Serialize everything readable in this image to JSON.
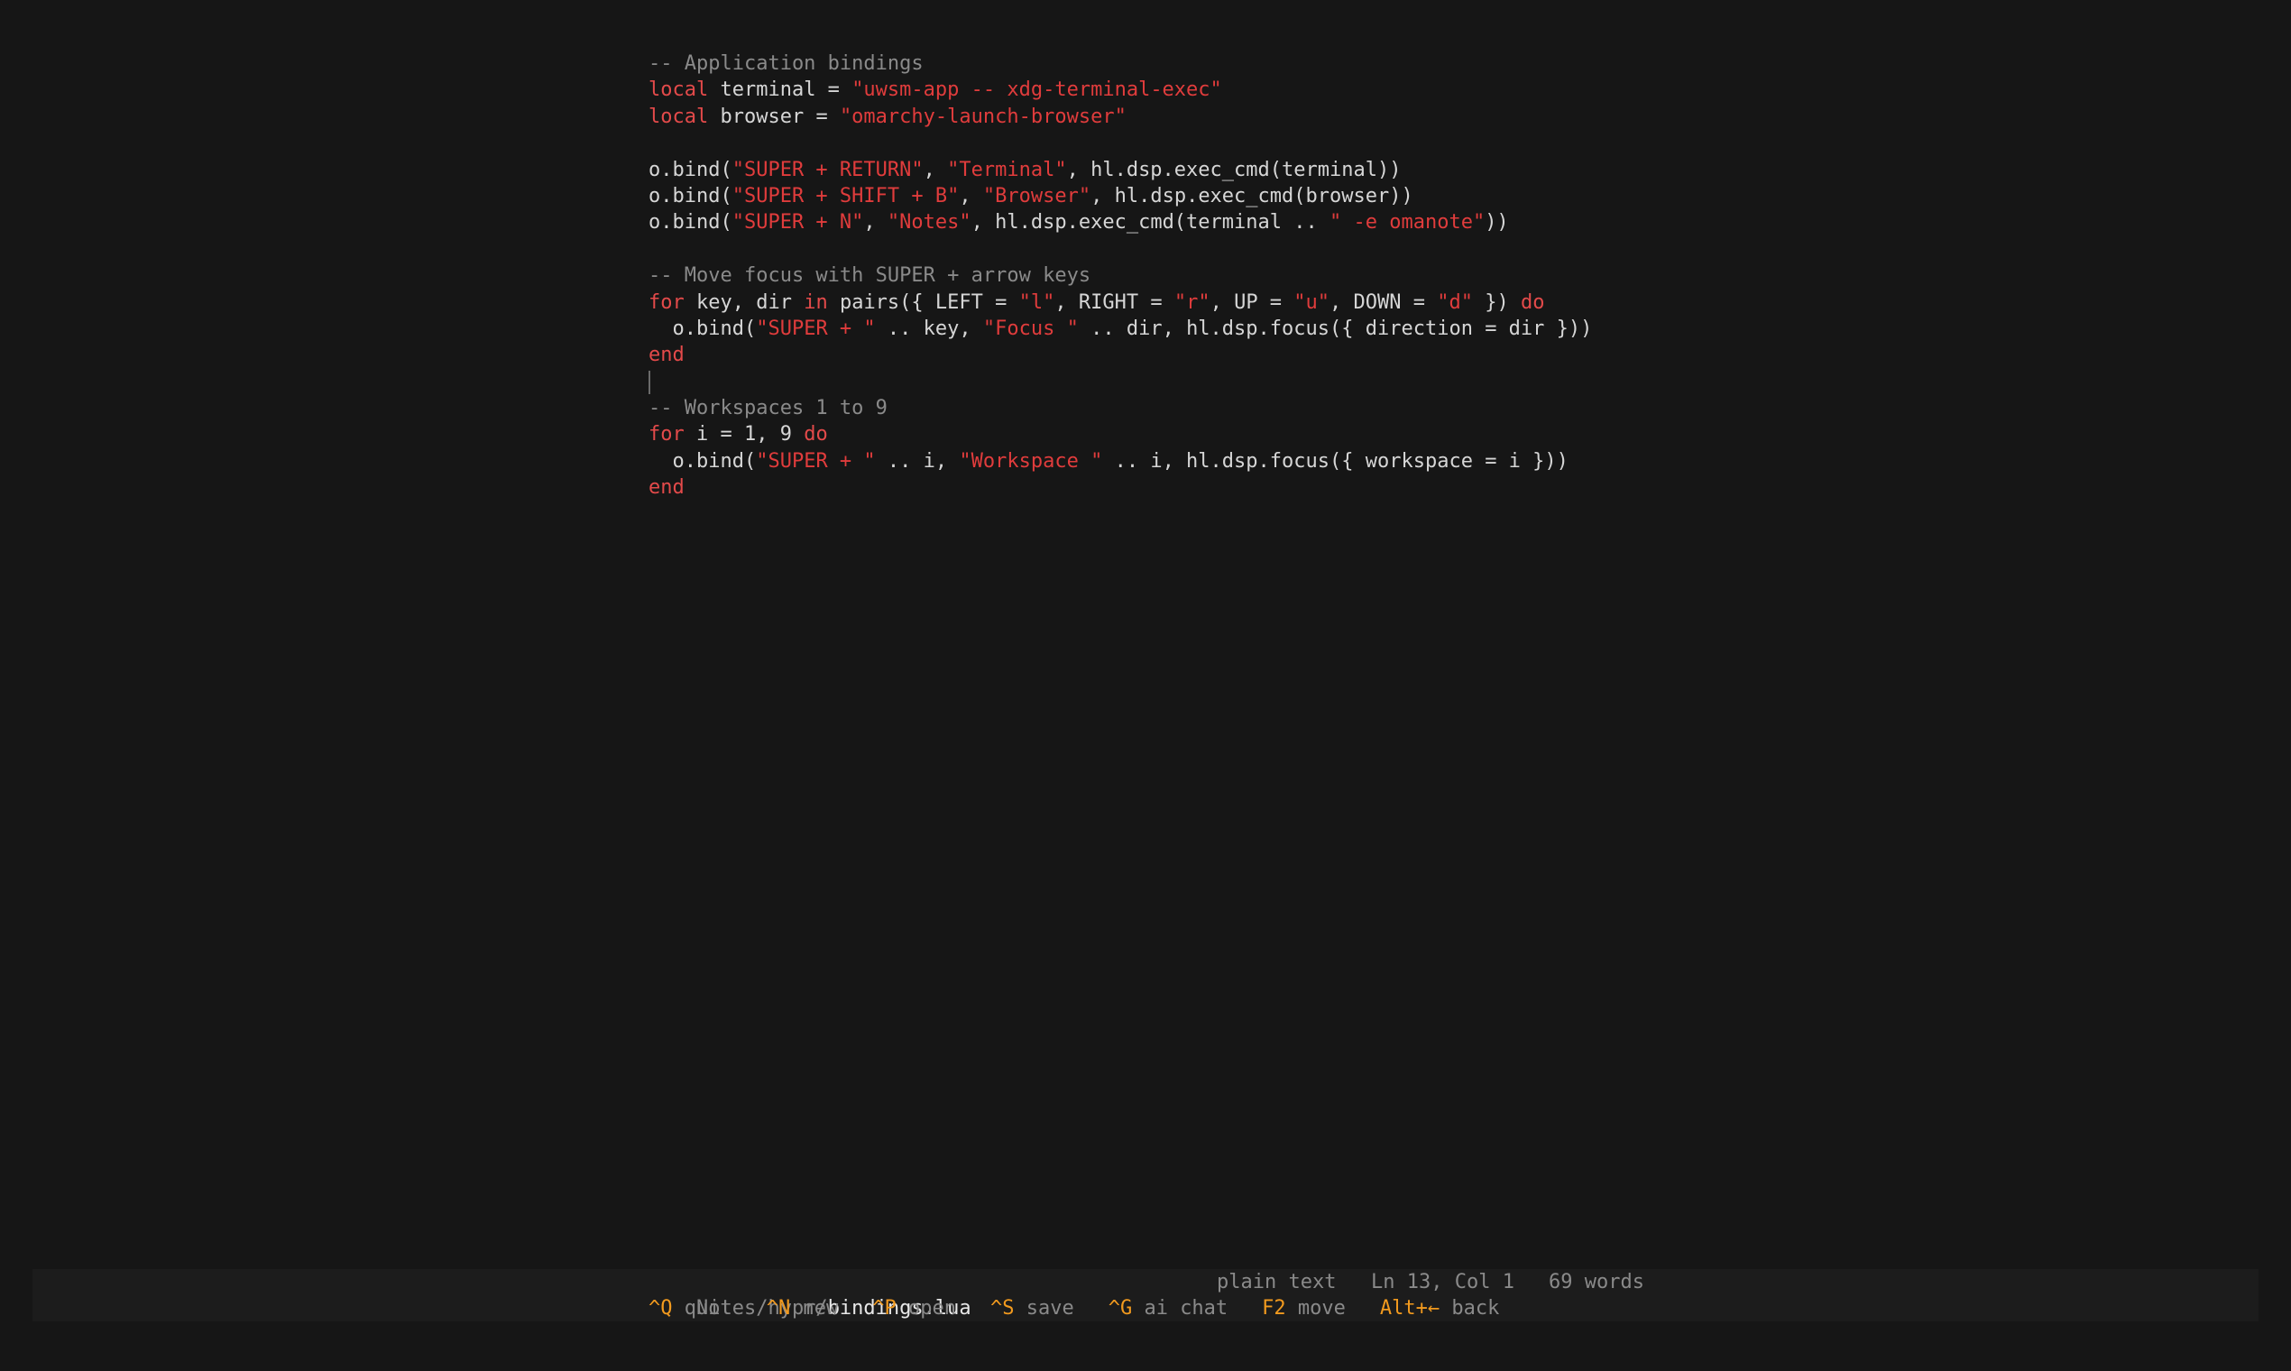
{
  "colors": {
    "background": "#161616",
    "status_bar_background": "#1c1c1c",
    "keyword": "#e34a4a",
    "string": "#e03c3c",
    "comment": "#8a8a8a",
    "plain": "#d6d6d6",
    "shortcut_key": "#f29a1e"
  },
  "editor": {
    "lines": [
      [
        {
          "t": "comment",
          "v": "-- Application bindings"
        }
      ],
      [
        {
          "t": "keyword",
          "v": "local"
        },
        {
          "t": "plain",
          "v": " terminal = "
        },
        {
          "t": "string",
          "v": "\"uwsm-app -- xdg-terminal-exec\""
        }
      ],
      [
        {
          "t": "keyword",
          "v": "local"
        },
        {
          "t": "plain",
          "v": " browser = "
        },
        {
          "t": "string",
          "v": "\"omarchy-launch-browser\""
        }
      ],
      [],
      [
        {
          "t": "plain",
          "v": "o.bind("
        },
        {
          "t": "string",
          "v": "\"SUPER + RETURN\""
        },
        {
          "t": "plain",
          "v": ", "
        },
        {
          "t": "string",
          "v": "\"Terminal\""
        },
        {
          "t": "plain",
          "v": ", hl.dsp.exec_cmd(terminal))"
        }
      ],
      [
        {
          "t": "plain",
          "v": "o.bind("
        },
        {
          "t": "string",
          "v": "\"SUPER + SHIFT + B\""
        },
        {
          "t": "plain",
          "v": ", "
        },
        {
          "t": "string",
          "v": "\"Browser\""
        },
        {
          "t": "plain",
          "v": ", hl.dsp.exec_cmd(browser))"
        }
      ],
      [
        {
          "t": "plain",
          "v": "o.bind("
        },
        {
          "t": "string",
          "v": "\"SUPER + N\""
        },
        {
          "t": "plain",
          "v": ", "
        },
        {
          "t": "string",
          "v": "\"Notes\""
        },
        {
          "t": "plain",
          "v": ", hl.dsp.exec_cmd(terminal .. "
        },
        {
          "t": "string",
          "v": "\" -e omanote\""
        },
        {
          "t": "plain",
          "v": "))"
        }
      ],
      [],
      [
        {
          "t": "comment",
          "v": "-- Move focus with SUPER + arrow keys"
        }
      ],
      [
        {
          "t": "keyword",
          "v": "for"
        },
        {
          "t": "plain",
          "v": " key, dir "
        },
        {
          "t": "keyword",
          "v": "in"
        },
        {
          "t": "plain",
          "v": " pairs({ LEFT = "
        },
        {
          "t": "string",
          "v": "\"l\""
        },
        {
          "t": "plain",
          "v": ", RIGHT = "
        },
        {
          "t": "string",
          "v": "\"r\""
        },
        {
          "t": "plain",
          "v": ", UP = "
        },
        {
          "t": "string",
          "v": "\"u\""
        },
        {
          "t": "plain",
          "v": ", DOWN = "
        },
        {
          "t": "string",
          "v": "\"d\""
        },
        {
          "t": "plain",
          "v": " }) "
        },
        {
          "t": "keyword",
          "v": "do"
        }
      ],
      [
        {
          "t": "plain",
          "v": "  o.bind("
        },
        {
          "t": "string",
          "v": "\"SUPER + \""
        },
        {
          "t": "plain",
          "v": " .. key, "
        },
        {
          "t": "string",
          "v": "\"Focus \""
        },
        {
          "t": "plain",
          "v": " .. dir, hl.dsp.focus({ direction = dir }))"
        }
      ],
      [
        {
          "t": "keyword",
          "v": "end"
        }
      ],
      [],
      [
        {
          "t": "comment",
          "v": "-- Workspaces 1 to 9"
        }
      ],
      [
        {
          "t": "keyword",
          "v": "for"
        },
        {
          "t": "plain",
          "v": " i = 1, 9 "
        },
        {
          "t": "keyword",
          "v": "do"
        }
      ],
      [
        {
          "t": "plain",
          "v": "  o.bind("
        },
        {
          "t": "string",
          "v": "\"SUPER + \""
        },
        {
          "t": "plain",
          "v": " .. i, "
        },
        {
          "t": "string",
          "v": "\"Workspace \""
        },
        {
          "t": "plain",
          "v": " .. i, hl.dsp.focus({ workspace = i }))"
        }
      ],
      [
        {
          "t": "keyword",
          "v": "end"
        }
      ]
    ],
    "cursor_line": 13
  },
  "status": {
    "path_dir": "Notes/hypr/",
    "file_name": "bindings.lua",
    "file_type": "plain text",
    "position": "Ln 13, Col 1",
    "word_count": "69 words"
  },
  "shortcuts": [
    {
      "key": "^Q",
      "action": "quit",
      "name": "quit"
    },
    {
      "key": "^N",
      "action": "new",
      "name": "new"
    },
    {
      "key": "^P",
      "action": "open",
      "name": "open"
    },
    {
      "key": "^S",
      "action": "save",
      "name": "save"
    },
    {
      "key": "^G",
      "action": "ai chat",
      "name": "ai-chat"
    },
    {
      "key": "F2",
      "action": "move",
      "name": "move"
    },
    {
      "key": "Alt+←",
      "action": "back",
      "name": "back"
    }
  ]
}
